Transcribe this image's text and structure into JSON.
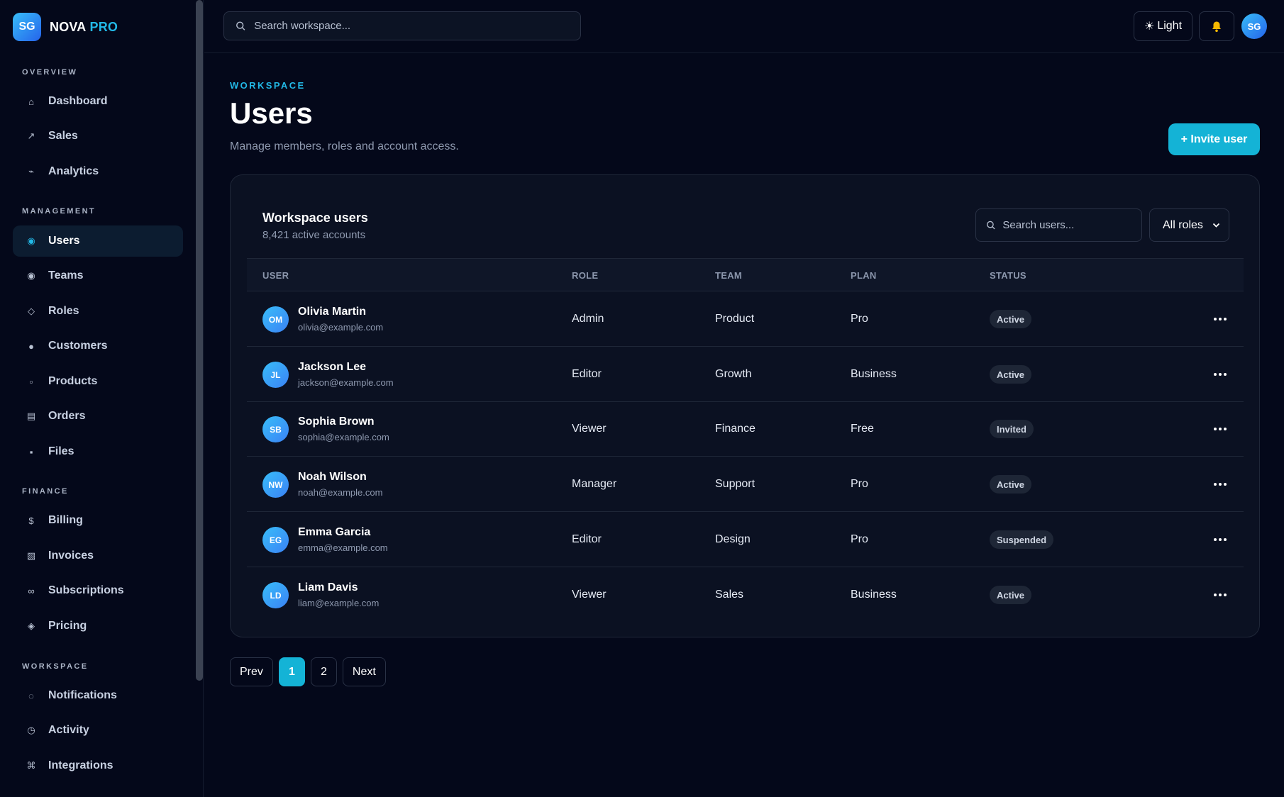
{
  "brand": {
    "logo": "SG",
    "name": "NOVA",
    "accent": "PRO"
  },
  "sidebar": {
    "sections": [
      {
        "title": "OVERVIEW",
        "items": [
          {
            "label": "Dashboard",
            "icon": "⌂"
          },
          {
            "label": "Sales",
            "icon": "↗"
          },
          {
            "label": "Analytics",
            "icon": "⌁"
          }
        ]
      },
      {
        "title": "MANAGEMENT",
        "items": [
          {
            "label": "Users",
            "icon": "◉",
            "active": true
          },
          {
            "label": "Teams",
            "icon": "◉"
          },
          {
            "label": "Roles",
            "icon": "◇"
          },
          {
            "label": "Customers",
            "icon": "●"
          },
          {
            "label": "Products",
            "icon": "▫"
          },
          {
            "label": "Orders",
            "icon": "▤"
          },
          {
            "label": "Files",
            "icon": "▪"
          }
        ]
      },
      {
        "title": "FINANCE",
        "items": [
          {
            "label": "Billing",
            "icon": "$"
          },
          {
            "label": "Invoices",
            "icon": "▧"
          },
          {
            "label": "Subscriptions",
            "icon": "∞"
          },
          {
            "label": "Pricing",
            "icon": "◈"
          }
        ]
      },
      {
        "title": "WORKSPACE",
        "items": [
          {
            "label": "Notifications",
            "icon": "◌"
          },
          {
            "label": "Activity",
            "icon": "◷"
          },
          {
            "label": "Integrations",
            "icon": "⌘"
          }
        ]
      }
    ]
  },
  "topbar": {
    "search_placeholder": "Search workspace...",
    "theme_label": "Light",
    "theme_icon": "☀",
    "avatar": "SG"
  },
  "header": {
    "eyebrow": "WORKSPACE",
    "title": "Users",
    "subtitle": "Manage members, roles and account access.",
    "invite_label": "+ Invite user"
  },
  "card": {
    "title": "Workspace users",
    "subtitle": "8,421 active accounts",
    "search_placeholder": "Search users...",
    "role_filter": "All roles",
    "columns": [
      "USER",
      "ROLE",
      "TEAM",
      "PLAN",
      "STATUS"
    ],
    "rows": [
      {
        "initials": "OM",
        "name": "Olivia Martin",
        "email": "olivia@example.com",
        "role": "Admin",
        "team": "Product",
        "plan": "Pro",
        "status": "Active"
      },
      {
        "initials": "JL",
        "name": "Jackson Lee",
        "email": "jackson@example.com",
        "role": "Editor",
        "team": "Growth",
        "plan": "Business",
        "status": "Active"
      },
      {
        "initials": "SB",
        "name": "Sophia Brown",
        "email": "sophia@example.com",
        "role": "Viewer",
        "team": "Finance",
        "plan": "Free",
        "status": "Invited"
      },
      {
        "initials": "NW",
        "name": "Noah Wilson",
        "email": "noah@example.com",
        "role": "Manager",
        "team": "Support",
        "plan": "Pro",
        "status": "Active"
      },
      {
        "initials": "EG",
        "name": "Emma Garcia",
        "email": "emma@example.com",
        "role": "Editor",
        "team": "Design",
        "plan": "Pro",
        "status": "Suspended"
      },
      {
        "initials": "LD",
        "name": "Liam Davis",
        "email": "liam@example.com",
        "role": "Viewer",
        "team": "Sales",
        "plan": "Business",
        "status": "Active"
      }
    ]
  },
  "pagination": {
    "prev": "Prev",
    "pages": [
      "1",
      "2"
    ],
    "current": "1",
    "next": "Next"
  },
  "colors": {
    "accent": "#14b3d6",
    "background": "#04081a",
    "card": "#0b1122"
  }
}
